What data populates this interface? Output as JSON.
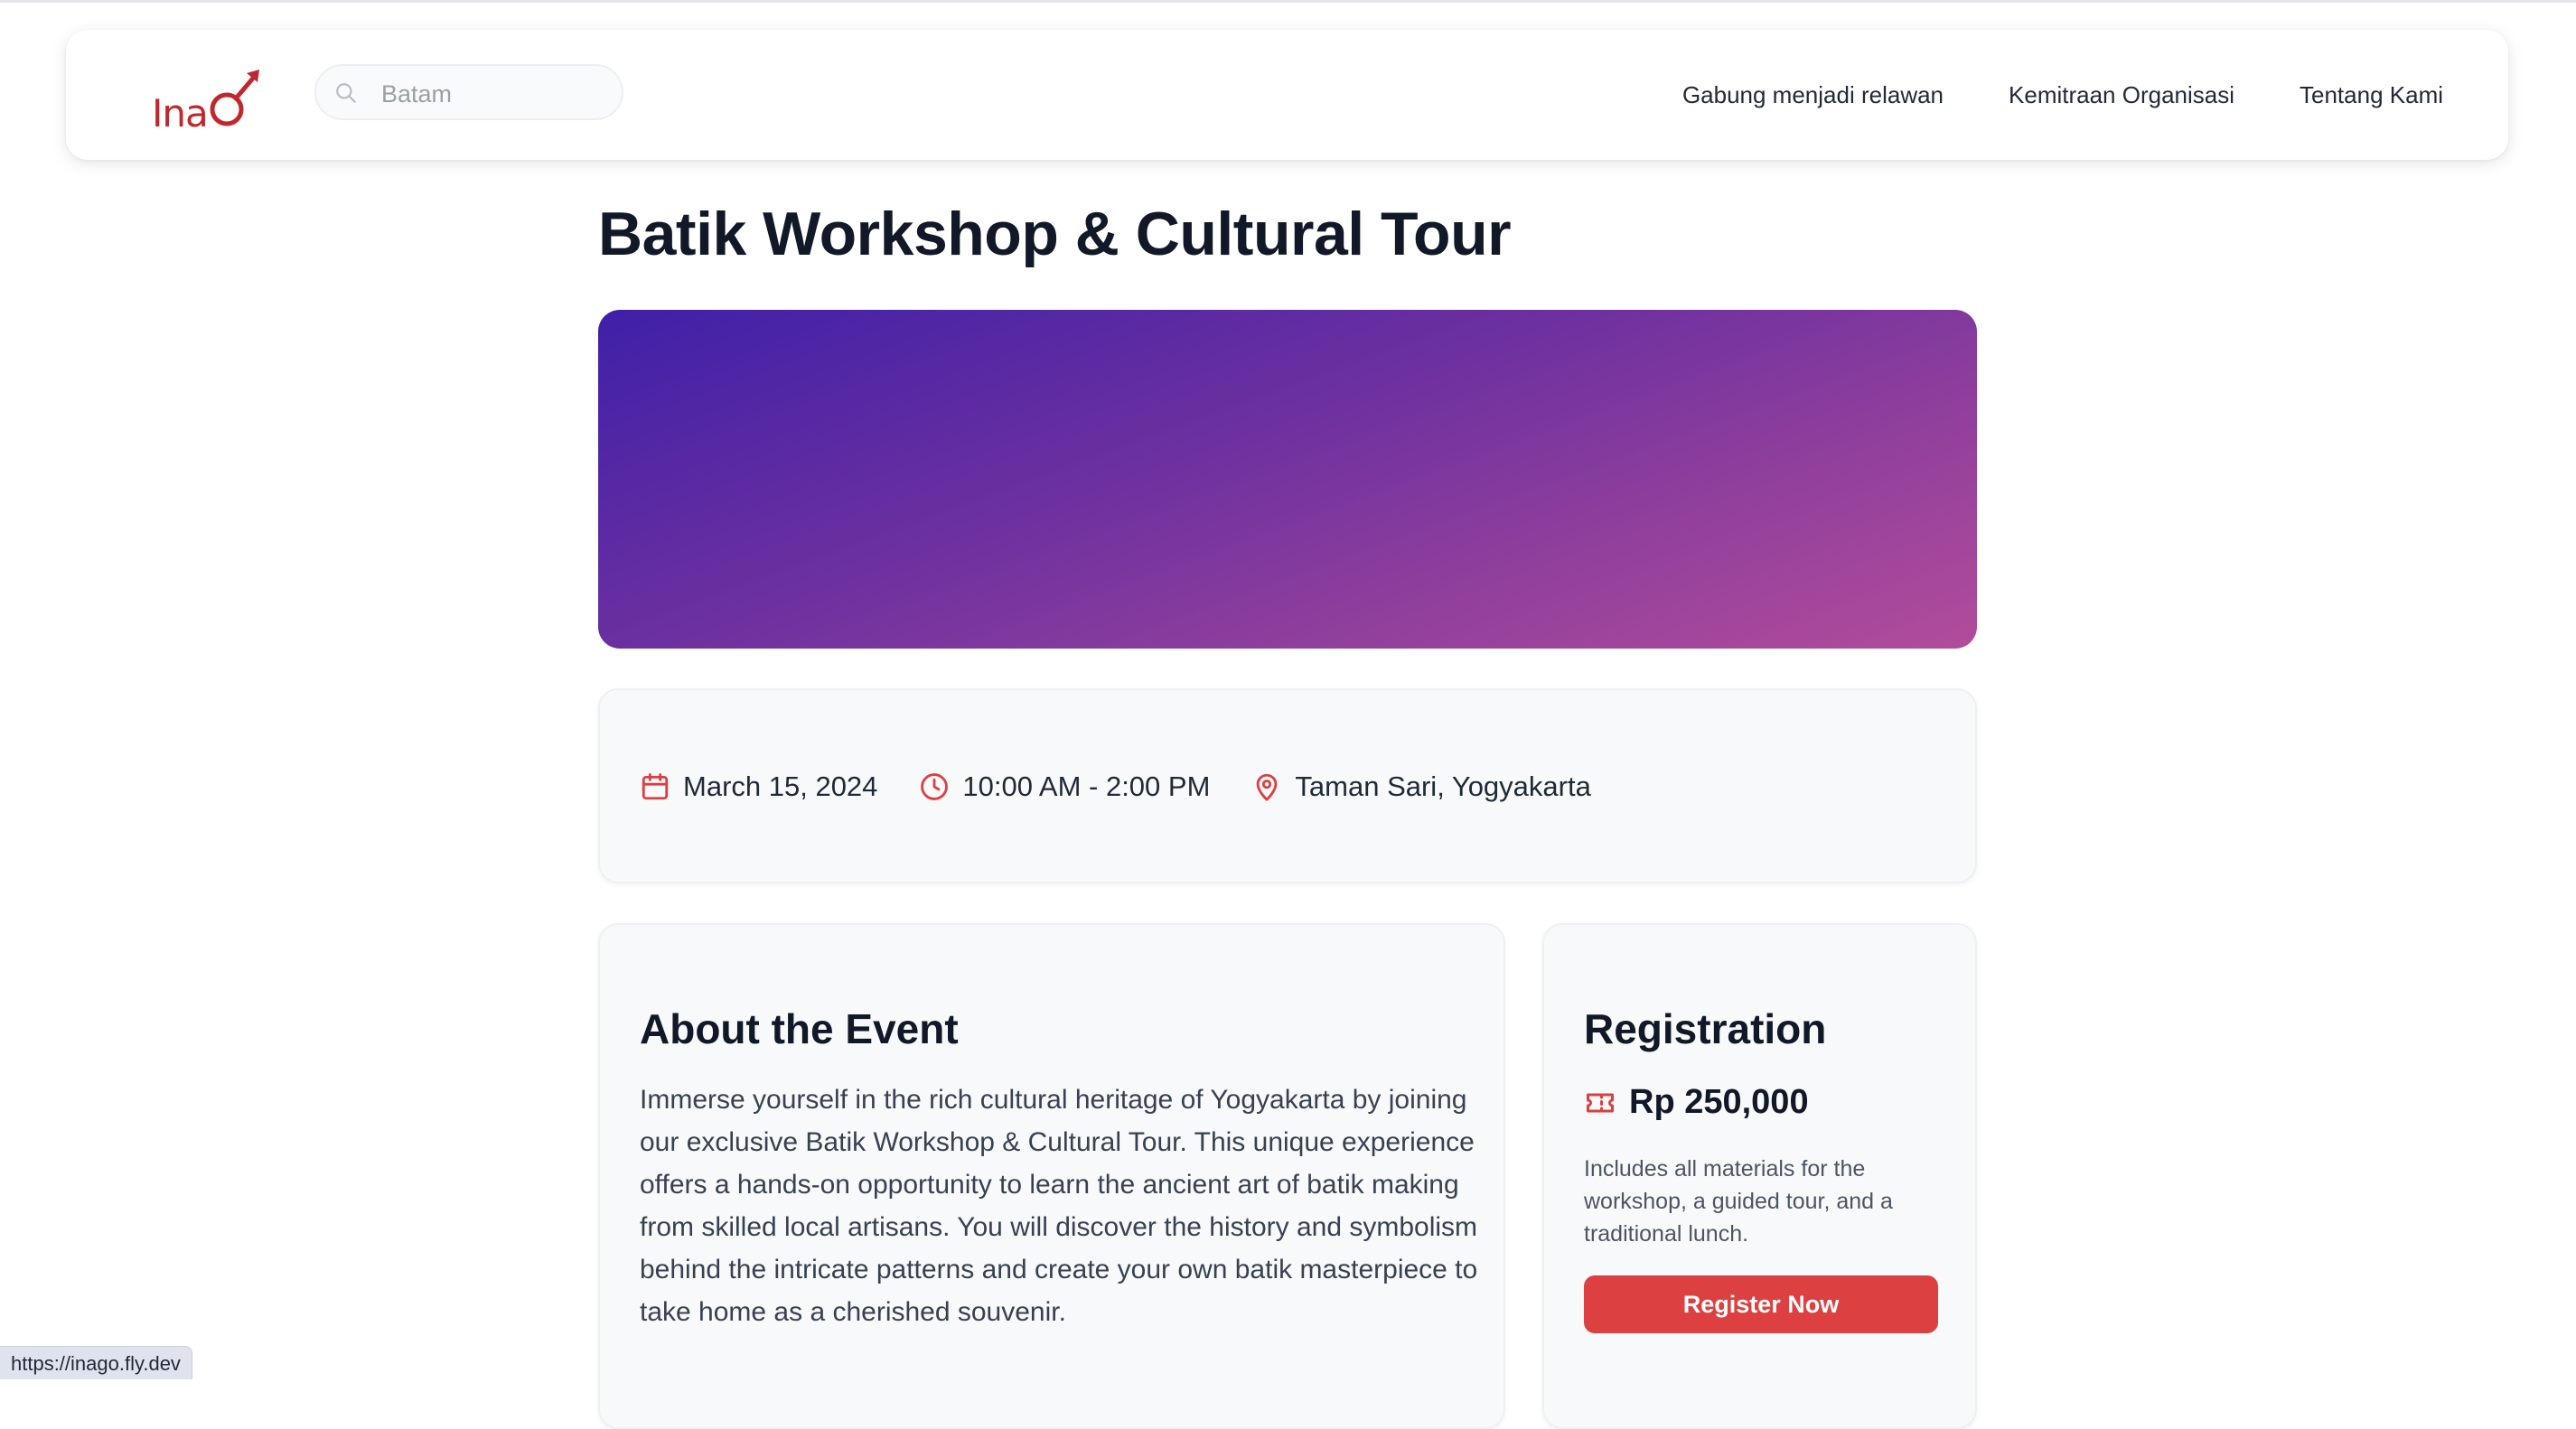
{
  "header": {
    "logo_text": "Ina",
    "search": {
      "placeholder": "Batam",
      "value": ""
    },
    "nav": [
      {
        "label": "Gabung menjadi relawan"
      },
      {
        "label": "Kemitraan Organisasi"
      },
      {
        "label": "Tentang Kami"
      }
    ]
  },
  "event": {
    "title": "Batik Workshop & Cultural Tour",
    "hero_colors": [
      "#3f20a8",
      "#b24c9b"
    ],
    "date": "March 15, 2024",
    "time": "10:00 AM - 2:00 PM",
    "location": "Taman Sari, Yogyakarta",
    "about_heading": "About the Event",
    "about_text": "Immerse yourself in the rich cultural heritage of Yogyakarta by joining our exclusive Batik Workshop & Cultural Tour. This unique experience offers a hands-on opportunity to learn the ancient art of batik making from skilled local artisans. You will discover the history and symbolism behind the intricate patterns and create your own batik masterpiece to take home as a cherished souvenir."
  },
  "registration": {
    "heading": "Registration",
    "price": "Rp 250,000",
    "description": "Includes all materials for the workshop, a guided tour, and a traditional lunch.",
    "button_label": "Register Now"
  },
  "icons": {
    "date": "calendar-icon",
    "time": "clock-icon",
    "location": "map-pin-icon",
    "price": "ticket-icon",
    "search": "search-icon"
  },
  "accent_color": "#dc4040",
  "status_bar": {
    "url": "https://inago.fly.dev"
  }
}
